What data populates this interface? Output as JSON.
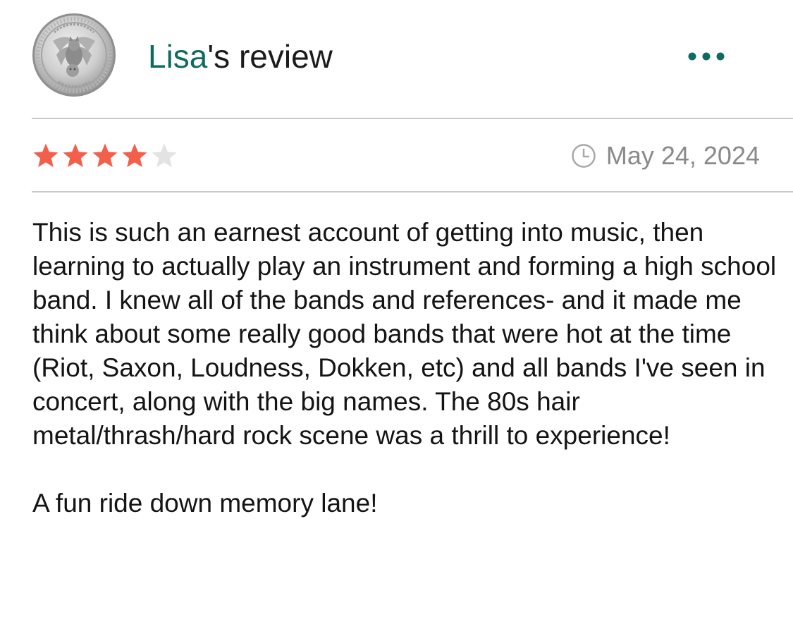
{
  "review": {
    "reviewer_name": "Lisa",
    "title_suffix": "'s review",
    "more_icon": "more-horizontal-icon",
    "avatar_icon": "coin-avatar-icon",
    "rating": 4,
    "rating_max": 5,
    "date": "May 24, 2024",
    "date_icon": "clock-icon",
    "paragraphs": [
      "This is such an earnest account of getting into music, then learning to actually play an instrument and forming a high school band. I knew all of the bands and references- and it made me think about some really good bands that were hot at the time (Riot, Saxon, Loudness, Dokken, etc) and all bands I've seen in concert, along with the big names. The 80s hair metal/thrash/hard rock scene was a thrill to experience!",
      "A fun ride down memory lane!"
    ]
  },
  "colors": {
    "accent": "#0f6b5e",
    "star_filled": "#f25f4a",
    "star_empty": "#e3e3e3",
    "muted_text": "#8a8a8a",
    "divider": "#c8c8c8"
  }
}
